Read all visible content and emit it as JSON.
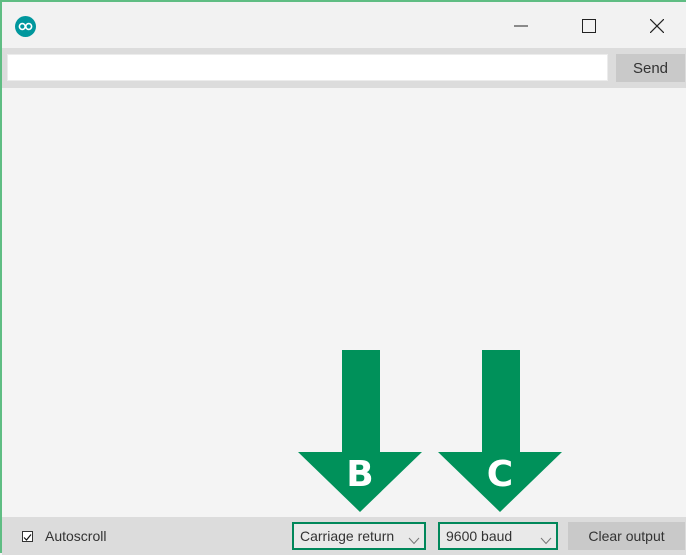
{
  "window": {
    "controls": {
      "minimize": "minimize-icon",
      "maximize": "maximize-icon",
      "close": "close-icon"
    }
  },
  "toolbar": {
    "input_value": "",
    "send_label": "Send"
  },
  "output": {
    "text": ""
  },
  "annotations": [
    {
      "label": "B",
      "color": "#00915a"
    },
    {
      "label": "C",
      "color": "#00915a"
    }
  ],
  "footer": {
    "autoscroll_label": "Autoscroll",
    "autoscroll_checked": true,
    "line_ending": "Carriage return",
    "baud_rate": "9600 baud",
    "clear_label": "Clear output"
  },
  "colors": {
    "accent": "#00915a",
    "app_icon": "#00979d",
    "window_border": "#5fbd83"
  }
}
